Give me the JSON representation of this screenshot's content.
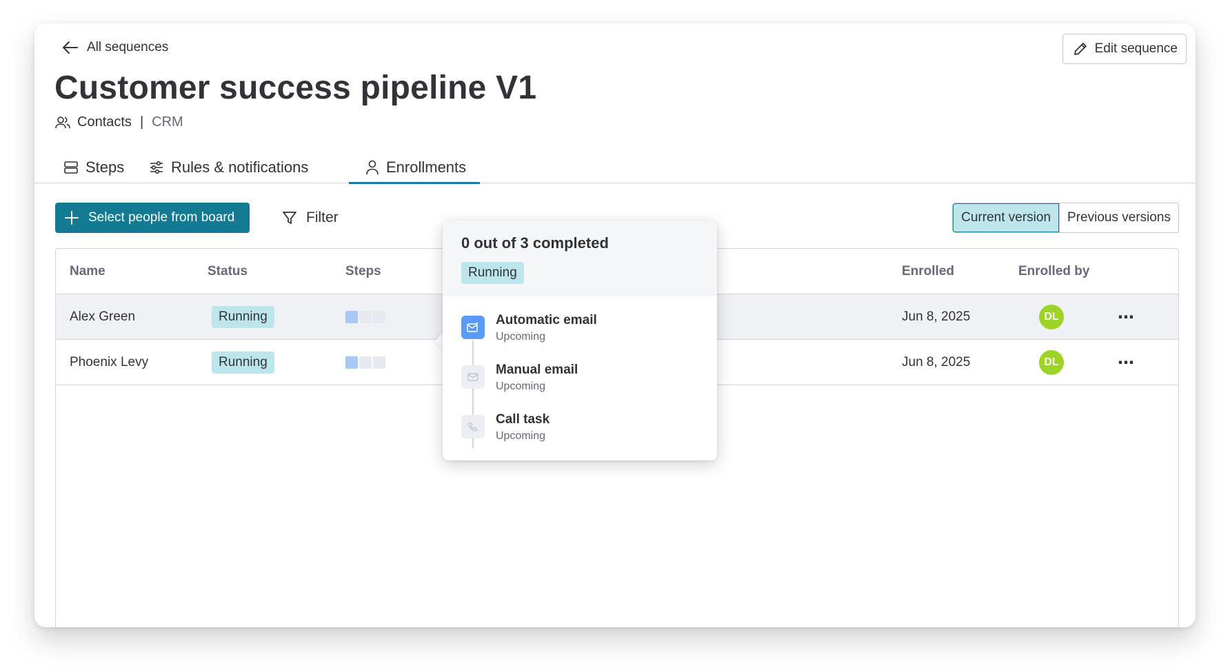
{
  "header": {
    "back_label": "All sequences",
    "edit_label": "Edit sequence",
    "title": "Customer success pipeline V1",
    "entity": "Contacts",
    "separator": "|",
    "product": "CRM"
  },
  "tabs": [
    {
      "label": "Steps",
      "icon": "steps-icon",
      "active": false
    },
    {
      "label": "Rules & notifications",
      "icon": "sliders-icon",
      "active": false
    },
    {
      "label": "Enrollments",
      "icon": "person-icon",
      "active": true
    }
  ],
  "toolbar": {
    "select_people_label": "Select people from board",
    "filter_label": "Filter",
    "versions": [
      {
        "label": "Current version",
        "selected": true
      },
      {
        "label": "Previous versions",
        "selected": false
      }
    ]
  },
  "table": {
    "columns": [
      "Name",
      "Status",
      "Steps",
      "Enrolled",
      "Enrolled by"
    ],
    "rows": [
      {
        "name": "Alex Green",
        "status": "Running",
        "steps_done": 1,
        "steps_total": 3,
        "enrolled": "Jun 8, 2025",
        "enrolled_by": "DL"
      },
      {
        "name": "Phoenix Levy",
        "status": "Running",
        "steps_done": 1,
        "steps_total": 3,
        "enrolled": "Jun 8, 2025",
        "enrolled_by": "DL"
      }
    ]
  },
  "popover": {
    "summary": "0 out of 3 completed",
    "status": "Running",
    "steps": [
      {
        "name": "Automatic email",
        "status": "Upcoming",
        "icon": "auto-email-icon"
      },
      {
        "name": "Manual email",
        "status": "Upcoming",
        "icon": "mail-icon"
      },
      {
        "name": "Call task",
        "status": "Upcoming",
        "icon": "phone-icon"
      }
    ]
  },
  "colors": {
    "primary": "#127a93",
    "badge": "#bde6ec",
    "avatar": "#9cd326",
    "tab_underline": "#1f76a3",
    "step_active": "#579bfc"
  }
}
